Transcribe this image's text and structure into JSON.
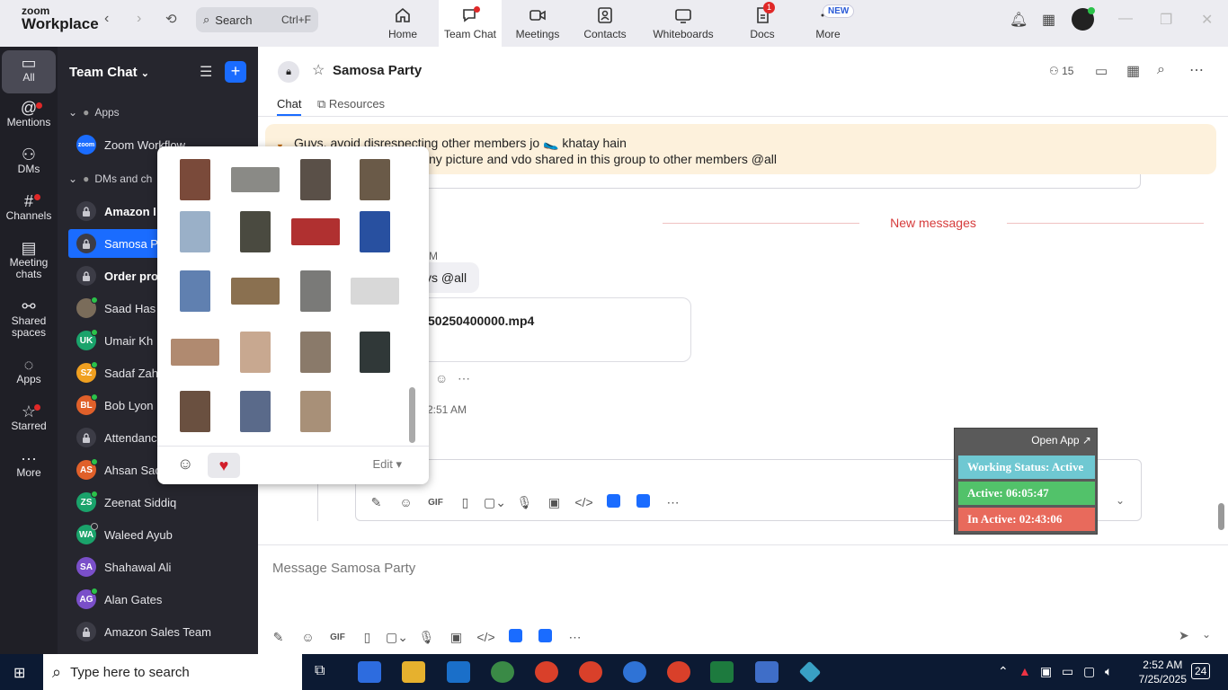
{
  "app": {
    "logo_line1": "zoom",
    "logo_line2": "Workplace",
    "search_label": "Search",
    "search_shortcut": "Ctrl+F"
  },
  "top_tabs": [
    {
      "label": "Home",
      "icon": "home-icon"
    },
    {
      "label": "Team Chat",
      "icon": "chat-icon",
      "active": true
    },
    {
      "label": "Meetings",
      "icon": "video-icon"
    },
    {
      "label": "Contacts",
      "icon": "contact-icon"
    },
    {
      "label": "Whiteboards",
      "icon": "whiteboard-icon"
    },
    {
      "label": "Docs",
      "icon": "docs-icon",
      "badge": "1"
    },
    {
      "label": "More",
      "icon": "more-icon",
      "badge": "NEW"
    }
  ],
  "rail": [
    {
      "label": "All",
      "icon": "chat-bubble-icon",
      "active": true
    },
    {
      "label": "Mentions",
      "icon": "at-icon"
    },
    {
      "label": "DMs",
      "icon": "people-icon"
    },
    {
      "label": "Channels",
      "icon": "hash-icon"
    },
    {
      "label1": "Meeting",
      "label2": "chats",
      "icon": "calendar-icon"
    },
    {
      "label1": "Shared",
      "label2": "spaces",
      "icon": "share-icon"
    },
    {
      "label": "Apps",
      "icon": "apps-icon"
    },
    {
      "label": "Starred",
      "icon": "star-icon"
    },
    {
      "label": "More",
      "icon": "ellipsis-icon"
    }
  ],
  "sidebar": {
    "title": "Team Chat",
    "section_apps": "Apps",
    "zoom_workflow": "Zoom Workflow",
    "section_dms": "DMs and ch",
    "items": [
      {
        "label": "Amazon I",
        "type": "lock",
        "bold": true
      },
      {
        "label": "Samosa P",
        "type": "lock",
        "active": true
      },
      {
        "label": "Order pro",
        "type": "lock",
        "bold": true
      },
      {
        "label": "Saad Has",
        "type": "photo",
        "status": "on"
      },
      {
        "label": "Umair Kh",
        "initials": "UK",
        "color": "#1aa36b",
        "status": "on"
      },
      {
        "label": "Sadaf Zah",
        "initials": "SZ",
        "color": "#f0a020",
        "status": "on"
      },
      {
        "label": "Bob Lyon",
        "initials": "BL",
        "color": "#e0602a",
        "status": "on"
      },
      {
        "label": "Attendanc",
        "type": "lock"
      },
      {
        "label": "Ahsan Sac",
        "initials": "AS",
        "color": "#e0602a",
        "status": "on"
      },
      {
        "label": "Zeenat Siddiq",
        "initials": "ZS",
        "color": "#1aa36b",
        "status": "on"
      },
      {
        "label": "Waleed Ayub",
        "initials": "WA",
        "color": "#1aa36b",
        "status": "off"
      },
      {
        "label": "Shahawal Ali",
        "initials": "SA",
        "color": "#7a4fc9",
        "status": "none"
      },
      {
        "label": "Alan Gates",
        "initials": "AG",
        "color": "#7a4fc9",
        "status": "on"
      },
      {
        "label": "Amazon Sales Team",
        "type": "lock"
      }
    ]
  },
  "chat": {
    "title": "Samosa Party",
    "member_count": "15",
    "tab_chat": "Chat",
    "tab_resources": "Resources",
    "banner_line1": "Guys, avoid disrespecting other members jo 🥿 khatay hain",
    "banner_line2": "ny picture and vdo shared in this group to other members @all",
    "new_messages": "New messages",
    "time_top": "M",
    "bubble_text": "ys @all",
    "file_name": "50250400000.mp4",
    "time_bottom": "2:51 AM",
    "composer_placeholder": "Message Samosa Party"
  },
  "status_widget": {
    "open_app": "Open App ↗",
    "working": "Working Status: Active",
    "active": "Active: 06:05:47",
    "inactive": "In Active: 02:43:06",
    "colors": {
      "working": "#6fc8d2",
      "active": "#52c26a",
      "inactive": "#e86a5c"
    }
  },
  "popup": {
    "edit_label": "Edit ▾"
  },
  "taskbar": {
    "search_placeholder": "Type here to search",
    "time": "2:52 AM",
    "date": "7/25/2025",
    "notif_count": "24"
  }
}
